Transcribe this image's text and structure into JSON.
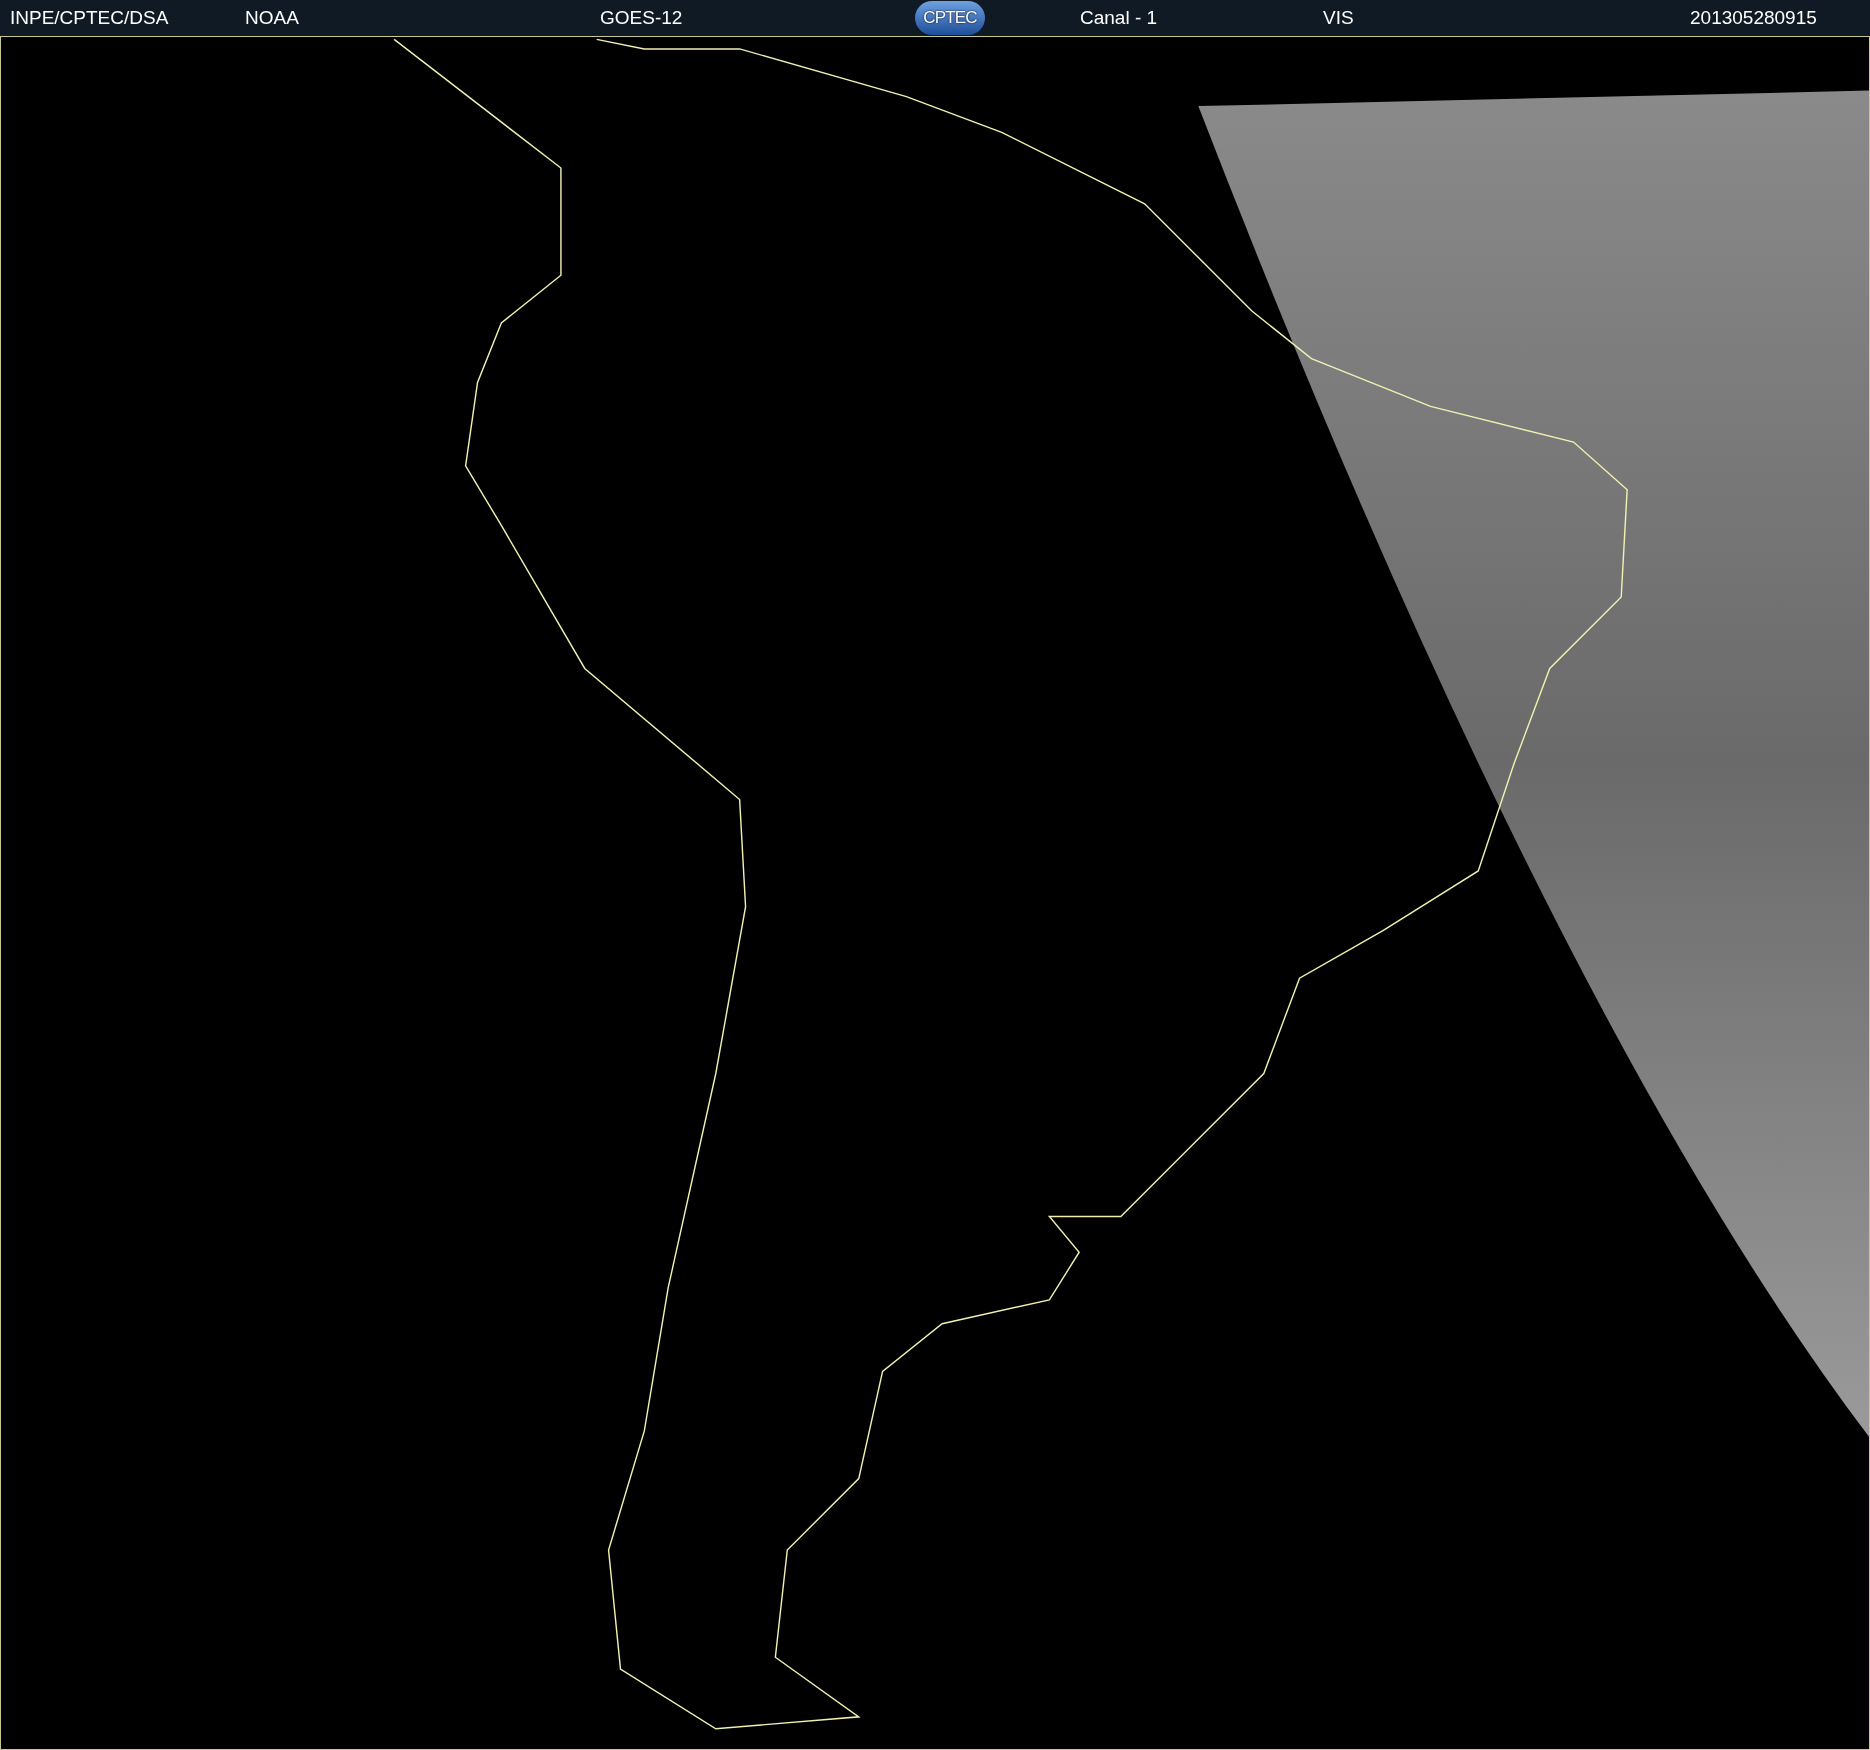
{
  "header": {
    "source": "INPE/CPTEC/DSA",
    "agency": "NOAA",
    "satellite": "GOES-12",
    "logo": "CPTEC",
    "channel": "Canal - 1",
    "band": "VIS",
    "timestamp": "201305280915"
  }
}
